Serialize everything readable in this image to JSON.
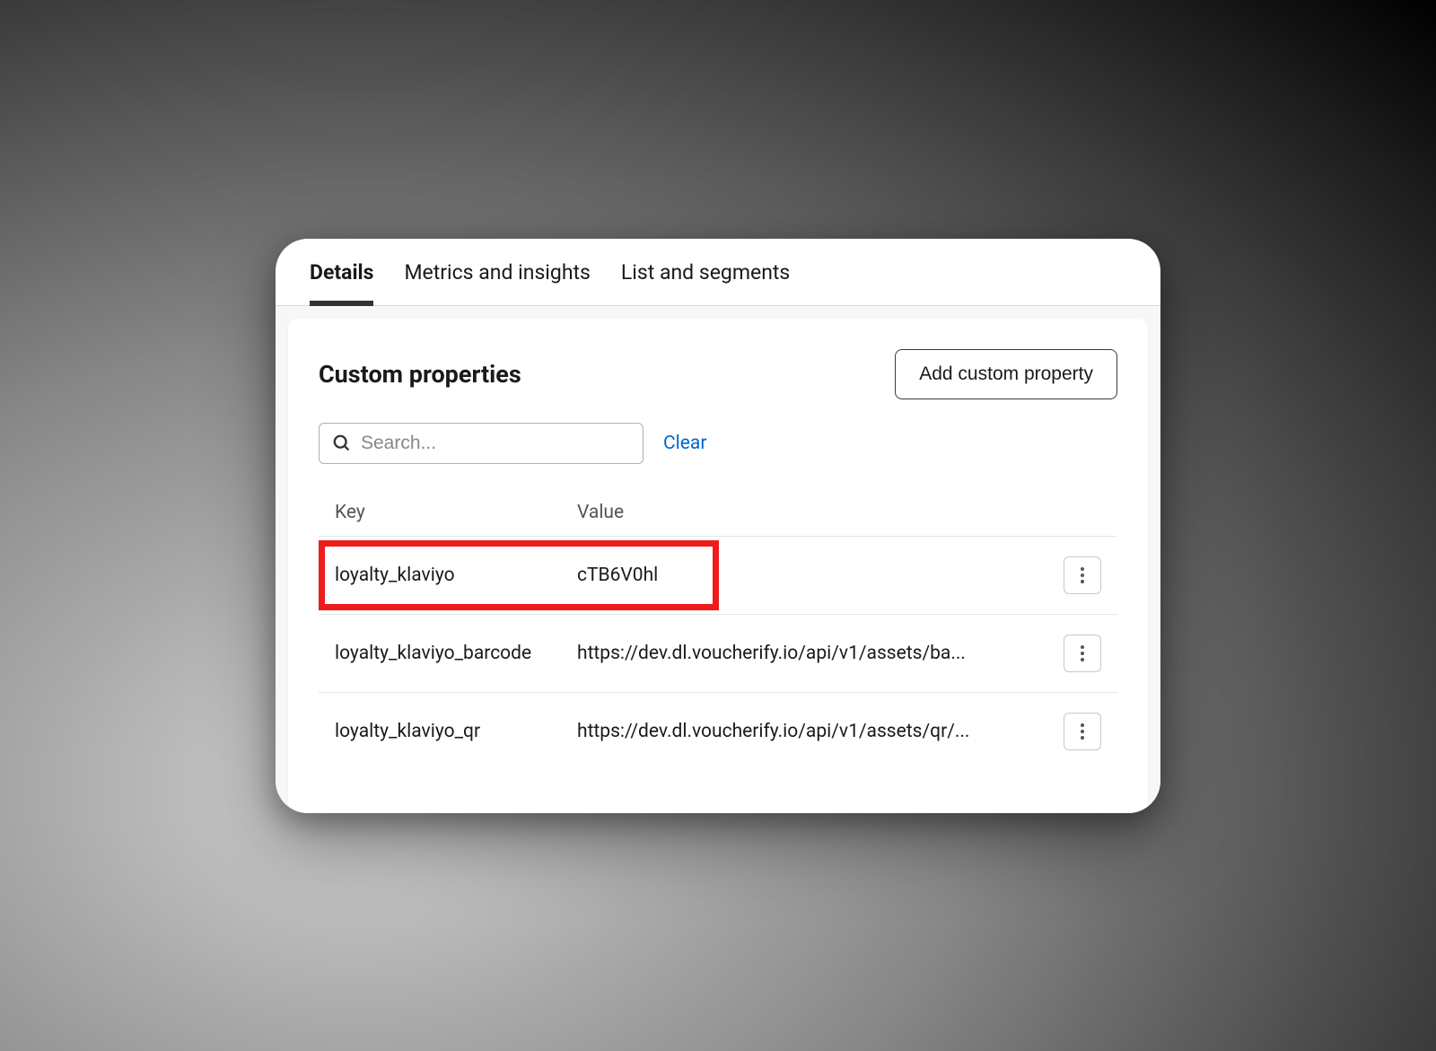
{
  "tabs": [
    {
      "label": "Details",
      "active": true
    },
    {
      "label": "Metrics and insights",
      "active": false
    },
    {
      "label": "List and segments",
      "active": false
    }
  ],
  "card": {
    "title": "Custom properties",
    "add_button": "Add custom property",
    "search_placeholder": "Search...",
    "clear_label": "Clear"
  },
  "table": {
    "headers": {
      "key": "Key",
      "value": "Value"
    },
    "rows": [
      {
        "key": "loyalty_klaviyo",
        "value": "cTB6V0hl",
        "highlighted": true
      },
      {
        "key": "loyalty_klaviyo_barcode",
        "value": "https://dev.dl.voucherify.io/api/v1/assets/ba...",
        "highlighted": false
      },
      {
        "key": "loyalty_klaviyo_qr",
        "value": "https://dev.dl.voucherify.io/api/v1/assets/qr/...",
        "highlighted": false
      }
    ]
  }
}
